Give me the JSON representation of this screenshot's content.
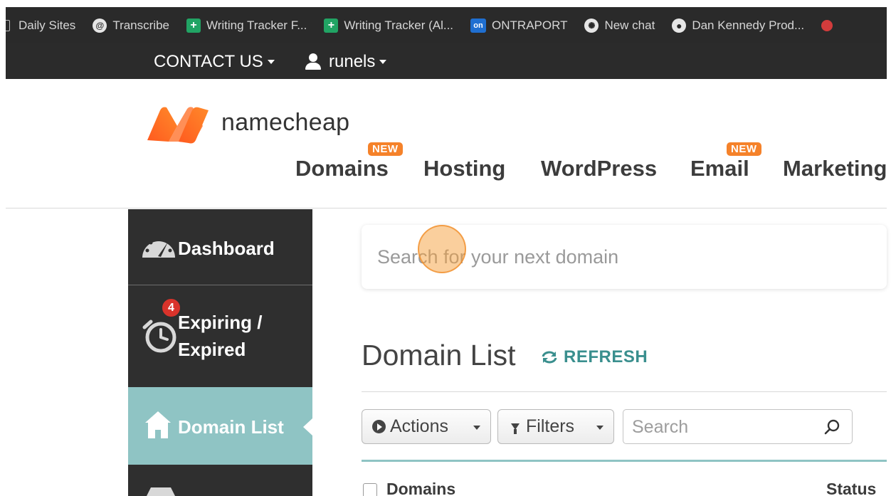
{
  "bookmarks": [
    {
      "label": "Daily Sites",
      "icon": "folder-icon"
    },
    {
      "label": "Transcribe",
      "icon": "transcribe-icon"
    },
    {
      "label": "Writing Tracker  F...",
      "icon": "google-sheets-icon"
    },
    {
      "label": "Writing Tracker (Al...",
      "icon": "google-sheets-icon"
    },
    {
      "label": "ONTRAPORT",
      "icon": "ontraport-icon"
    },
    {
      "label": "New chat",
      "icon": "openai-icon"
    },
    {
      "label": "Dan Kennedy Prod...",
      "icon": "globe-icon"
    }
  ],
  "topnav": {
    "contact_label": "CONTACT US",
    "user_label": "runels"
  },
  "header": {
    "logo_text": "namecheap",
    "new_badge": "NEW",
    "nav": [
      "Domains",
      "Hosting",
      "WordPress",
      "Email",
      "Marketing"
    ]
  },
  "sidebar": {
    "dashboard": "Dashboard",
    "expiring_line1": "Expiring /",
    "expiring_line2": "Expired",
    "expiring_count": "4",
    "domain_list": "Domain List"
  },
  "search": {
    "placeholder": "Search for your next domain"
  },
  "main": {
    "title": "Domain List",
    "refresh_label": "REFRESH",
    "actions_label": "Actions",
    "filters_label": "Filters",
    "table_search_placeholder": "Search",
    "columns": [
      "Domains",
      "Status"
    ]
  },
  "colors": {
    "brand_orange": "#f5822a",
    "teal_accent": "#3a8f8e",
    "sidebar_active": "#8fc4c4",
    "sidebar_bg": "#2f2f2f",
    "badge_red": "#d9332b"
  }
}
